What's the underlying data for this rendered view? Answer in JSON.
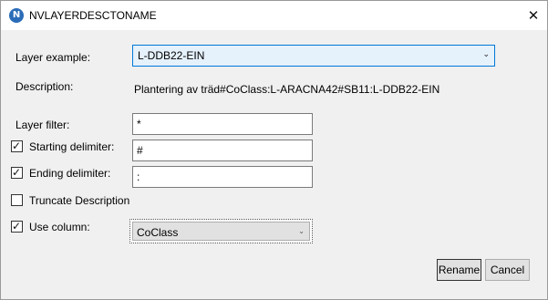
{
  "window": {
    "title": "NVLAYERDESCTONAME",
    "app_icon_letter": "N",
    "close_glyph": "✕"
  },
  "form": {
    "layer_example_label": "Layer example:",
    "layer_example_value": "L-DDB22-EIN",
    "description_label": "Description:",
    "description_value": "Plantering av träd#CoClass:L-ARACNA42#SB11:L-DDB22-EIN",
    "layer_filter_label": "Layer filter:",
    "layer_filter_value": "*",
    "starting_delimiter_label": "Starting delimiter:",
    "starting_delimiter_checked": true,
    "starting_delimiter_value": "#",
    "ending_delimiter_label": "Ending delimiter:",
    "ending_delimiter_checked": true,
    "ending_delimiter_value": ":",
    "truncate_label": "Truncate Description",
    "truncate_checked": false,
    "use_column_label": "Use column:",
    "use_column_checked": true,
    "use_column_value": "CoClass"
  },
  "buttons": {
    "rename": "Rename",
    "cancel": "Cancel"
  },
  "glyphs": {
    "check": "✓",
    "dropdown_arrow": "⌄"
  },
  "colors": {
    "accent": "#0078d7",
    "combo_highlight": "#e5f1fb",
    "app_icon": "#2b6cb8"
  }
}
